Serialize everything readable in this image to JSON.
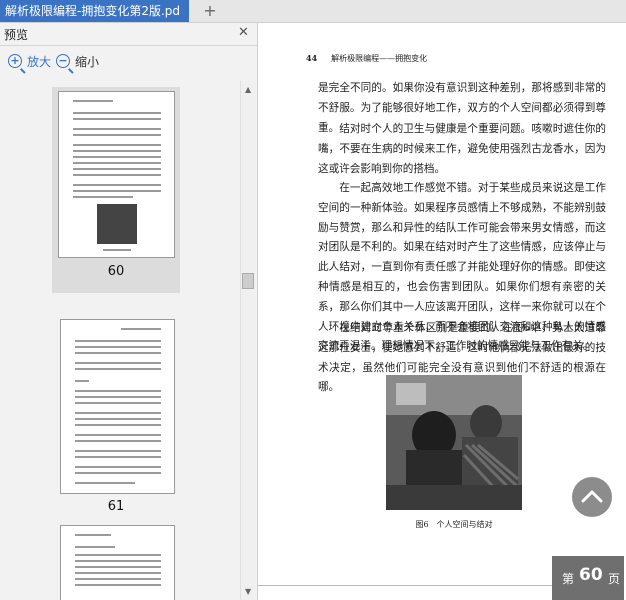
{
  "tab": {
    "title": "解析极限编程-拥抱变化第2版.pd"
  },
  "panel": {
    "title": "预览",
    "zoom_in": "放大",
    "zoom_out": "缩小"
  },
  "thumbnails": [
    {
      "page": "60",
      "selected": true
    },
    {
      "page": "61",
      "selected": false
    }
  ],
  "page": {
    "running_head_num": "44",
    "running_head_title": "解析极限编程——拥抱变化",
    "paragraphs": [
      "是完全不同的。如果你没有意识到这种差别，那将感到非常的不舒服。为了能够很好地工作，双方的个人空间都必须得到尊重。",
      "结对时个人的卫生与健康是个重要问题。咳嗽时遮住你的嘴，不要在生病的时候来工作，避免使用强烈古龙香水，因为这或许会影响到你的搭档。",
      "在一起高效地工作感觉不错。对于某些成员来说这是工作空间的一种新体验。如果程序员感情上不够成熟，不能辨别鼓励与赞赏，那么和异性的结队工作可能会带来男女情感，而这对团队是不利的。如果在结对时产生了这些情感，应该停止与此人结对，一直到你有责任感了并能处理好你的情感。即使这种情感是相互的，也会伤害到团队。如果你们想有亲密的关系，那么你们其中一人应该离开团队，这样一来你就可以在个人环境中建立个人关系，而不会将团队交流和这种私人的情感交流弄混淆。理想情况下，工作时的情感只能与工作有关。",
      "在结对时尊重个体区别是重要的。在图6中，男士太过靠近那位女士，使她感到不舒适。这时他俩都无法做出最好的技术决定，虽然他们可能完全没有意识到他们不舒适的根源在哪。"
    ],
    "figure_caption": "图6　个人空间与结对"
  },
  "page_indicator": {
    "prefix": "第",
    "number": "60",
    "suffix": "页"
  },
  "colors": {
    "accent": "#3b73c4",
    "badge": "#6f6f6f"
  }
}
